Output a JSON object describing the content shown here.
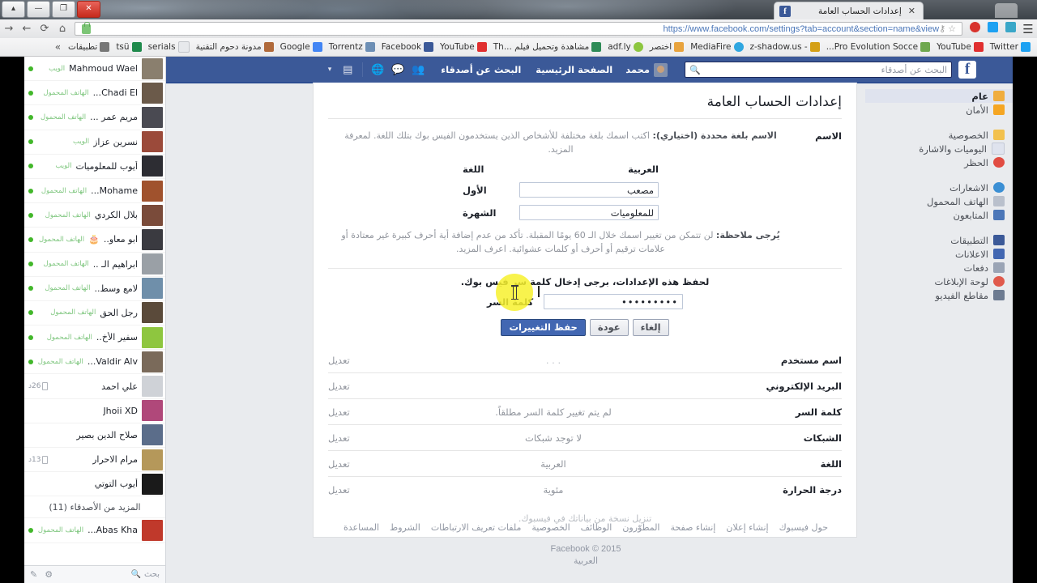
{
  "browser": {
    "tab_title": "إعدادات الحساب العامة",
    "tab_close": "✕",
    "url": "https://www.facebook.com/settings?tab=account&section=name&view",
    "icons": {
      "menu": "hamburger-icon",
      "back": "←",
      "forward": "→",
      "reload": "⟳",
      "home": "⌂",
      "star": "☆",
      "key": "⚷"
    },
    "bookmarks": [
      {
        "label": "Twitter",
        "color": "#1da1f2"
      },
      {
        "label": "YouTube",
        "color": "#e02f2f"
      },
      {
        "label": "Pro Evolution Socce...",
        "color": "#6fa84f"
      },
      {
        "label": "- z-shadow.us",
        "color": "#d4a017"
      },
      {
        "label": "MediaFire",
        "color": "#2fa6e0"
      },
      {
        "label": "اختصر",
        "color": "#e8a33d"
      },
      {
        "label": "adf.ly",
        "color": "#8cc63f"
      },
      {
        "label": "مشاهدة وتحميل فيلم ...Th",
        "color": "#2e8b57"
      },
      {
        "label": "YouTube",
        "color": "#e02f2f"
      },
      {
        "label": "Facebook",
        "color": "#3b5998"
      },
      {
        "label": "Torrentz",
        "color": "#6d8fb5"
      },
      {
        "label": "Google",
        "color": "#4285f4"
      },
      {
        "label": "مدونة دحوم التقنية",
        "color": "#b06a3b"
      },
      {
        "label": "serials",
        "color": "#c9ccd1"
      },
      {
        "label": "tsü",
        "color": "#1f8a4c"
      },
      {
        "label": "تطبيقات",
        "color": "#777777"
      }
    ],
    "bookmarks_overflow": "»"
  },
  "facebook_bar": {
    "search_placeholder": "البحث عن أصدقاء",
    "search_icon": "search-icon",
    "logo": "f",
    "profile_name": "محمد",
    "home_link": "الصفحة الرئيسية",
    "find_friends_link": "البحث عن أصدقاء",
    "friend_requests_icon": "friend-requests-icon",
    "messages_icon": "messages-icon",
    "notifications_icon": "globe-notifications-icon",
    "privacy_icon": "privacy-shortcuts-icon",
    "caret_icon": "chevron-down-icon"
  },
  "settings_nav": {
    "groups": [
      [
        {
          "label": "عام",
          "icon": "general-gear-icon",
          "color": "#f0ad3e",
          "active": true
        },
        {
          "label": "الأمان",
          "icon": "security-lock-icon",
          "color": "#f5a623",
          "active": false
        }
      ],
      [
        {
          "label": "الخصوصية",
          "icon": "privacy-lock-icon",
          "color": "#f2c14e",
          "active": false
        },
        {
          "label": "اليوميات والاشارة",
          "icon": "timeline-tagging-icon",
          "color": "#dfe3ee",
          "active": false
        },
        {
          "label": "الحظر",
          "icon": "blocking-icon",
          "color": "#e14c42",
          "active": false
        }
      ],
      [
        {
          "label": "الاشعارات",
          "icon": "notifications-globe-icon",
          "color": "#3b8fd4",
          "active": false
        },
        {
          "label": "الهاتف المحمول",
          "icon": "mobile-phone-icon",
          "color": "#b9c0cc",
          "active": false
        },
        {
          "label": "المتابعون",
          "icon": "followers-rss-icon",
          "color": "#4b76b8",
          "active": false
        }
      ],
      [
        {
          "label": "التطبيقات",
          "icon": "apps-icon",
          "color": "#3b5998",
          "active": false
        },
        {
          "label": "الاعلانات",
          "icon": "ads-icon",
          "color": "#4267b2",
          "active": false
        },
        {
          "label": "دفعات",
          "icon": "payments-card-icon",
          "color": "#9aa4b5",
          "active": false
        },
        {
          "label": "لوحة الإبلاغات",
          "icon": "support-inbox-icon",
          "color": "#e05a4c",
          "active": false
        },
        {
          "label": "مقاطع الفيديو",
          "icon": "videos-icon",
          "color": "#6d7b91",
          "active": false
        }
      ]
    ]
  },
  "main": {
    "page_title": "إعدادات الحساب العامة",
    "name_section": {
      "label": "الاسم",
      "description_bold": "الاسم بلغة محددة (اختياري):",
      "description_rest": " اكتب اسمك بلغة مختلفة للأشخاص الذين يستخدمون الفيس بوك بتلك اللغة. لمعرفة المزيد.",
      "language_label": "اللغة",
      "language_value": "العربية",
      "first_label": "الأول",
      "first_value": "مصعب",
      "last_label": "الشهرة",
      "last_value": "للمعلوميات",
      "note_bold": "يُرجى ملاحظة:",
      "note_rest": " لن تتمكن من تغيير اسمك خلال الـ 60 يومًا المقبلة. تأكد من عدم إضافة أية أحرف كبيرة غير معتادة أو علامات ترقيم أو أحرف أو كلمات عشوائية. اعرف المزيد."
    },
    "password_prompt": "لحفظ هذه الإعدادات، برجى إدخال كلمة سر فيس بوك.",
    "password_label": "كلمة السر",
    "password_value": "•••••••••",
    "buttons": {
      "save": "حفظ التغييرات",
      "back": "عودة",
      "cancel": "إلغاء"
    },
    "rows": [
      {
        "key": "اسم مستخدم",
        "value": ". . .",
        "edit": "تعديل",
        "dim": true
      },
      {
        "key": "البريد الإلكتروني",
        "value": "",
        "edit": "تعديل",
        "dim": false
      },
      {
        "key": "كلمة السر",
        "value": "لم يتم تغيير كلمة السر مطلقاً.",
        "edit": "تعديل",
        "dim": false
      },
      {
        "key": "الشبكات",
        "value": "لا توجد شبكات",
        "edit": "تعديل",
        "dim": false
      },
      {
        "key": "اللغة",
        "value": "العربية",
        "edit": "تعديل",
        "dim": false
      },
      {
        "key": "درجة الحرارة",
        "value": "مئوية",
        "edit": "تعديل",
        "dim": false
      }
    ],
    "download_link": "تنزيل نسخة من بياناتك في فيسبوك."
  },
  "footer": {
    "links": [
      "حول فيسبوك",
      "إنشاء إعلان",
      "إنشاء صفحة",
      "المطوّرون",
      "الوظائف",
      "الخصوصية",
      "ملفات تعريف الارتباطات",
      "الشروط",
      "المساعدة"
    ],
    "copyright": "Facebook © 2015",
    "language": "العربية"
  },
  "chat": {
    "contacts": [
      {
        "name": "Mahmoud Wael",
        "status": "الويب",
        "online": true,
        "avatar": "#8a7f6e"
      },
      {
        "name": "Chadi El...",
        "status": "الهاتف المحمول",
        "online": true,
        "avatar": "#6b5a4a"
      },
      {
        "name": "مريم عمر ...",
        "status": "الهاتف المحمول",
        "online": true,
        "avatar": "#4a4a52"
      },
      {
        "name": "نسرين عزاز",
        "status": "الويب",
        "online": true,
        "avatar": "#9b4a3a"
      },
      {
        "name": "أيوب للمعلوميات",
        "status": "الويب",
        "online": true,
        "avatar": "#2d2d33"
      },
      {
        "name": "Mohame...",
        "status": "الهاتف المحمول",
        "online": true,
        "avatar": "#a0522d"
      },
      {
        "name": "بلال الكردي",
        "status": "الهاتف المحمول",
        "online": true,
        "avatar": "#7a4b3a"
      },
      {
        "name": "ابو معاو..",
        "status": "الهاتف المحمول",
        "online": true,
        "avatar": "#3a3a40",
        "badge": "🎂"
      },
      {
        "name": "ابراهيم الـ ..",
        "status": "الهاتف المحمول",
        "online": true,
        "avatar": "#9aa0a6"
      },
      {
        "name": "لامع وسط..",
        "status": "الهاتف المحمول",
        "online": true,
        "avatar": "#6f8faa"
      },
      {
        "name": "رجل الحق",
        "status": "الهاتف المحمول",
        "online": true,
        "avatar": "#5a4a3a"
      },
      {
        "name": "سفير الأخ..",
        "status": "الهاتف المحمول",
        "online": true,
        "avatar": "#8ec63f"
      },
      {
        "name": "Valdir Alv...",
        "status": "الهاتف المحمول",
        "online": true,
        "avatar": "#7a6a5a"
      },
      {
        "name": "علي احمد",
        "idle": "26د",
        "online": false,
        "avatar": "#cfd2d7"
      },
      {
        "name": "Jhoii XD",
        "idle": "",
        "online": false,
        "avatar": "#b0487a"
      },
      {
        "name": "صلاح الدين بصير",
        "idle": "",
        "online": false,
        "avatar": "#5b6d8a"
      },
      {
        "name": "مرام الاحرار",
        "idle": "13د",
        "online": false,
        "avatar": "#b5985a"
      },
      {
        "name": "أيوب التوتي",
        "idle": "",
        "online": false,
        "avatar": "#1a1a1a"
      }
    ],
    "more_friends": "المزيد من الأصدقاء (11)",
    "extra_contact": {
      "name": "Abas Kha...",
      "status": "الهاتف المحمول",
      "online": true,
      "avatar": "#c0392b"
    },
    "footer": {
      "search_label": "بحث",
      "search_icon": "search-icon",
      "gear_icon": "gear-icon",
      "compose_icon": "compose-icon"
    }
  }
}
